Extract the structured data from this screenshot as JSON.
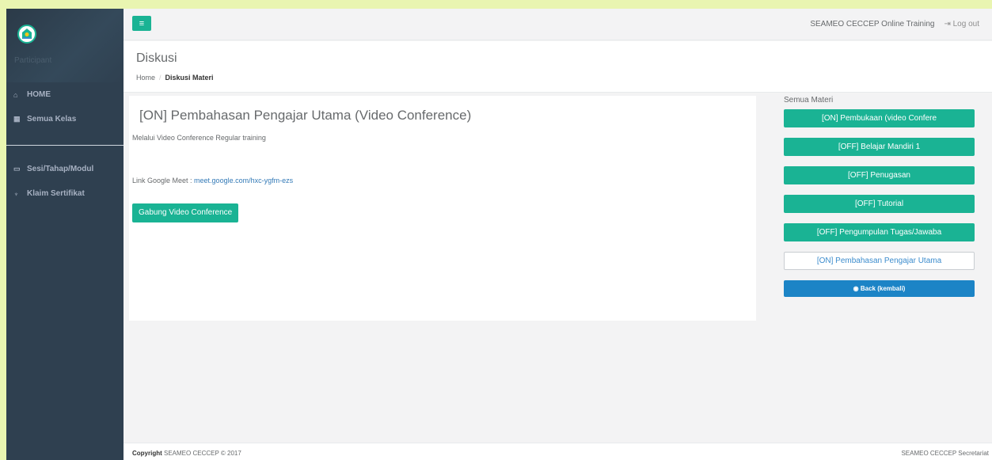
{
  "sidebar": {
    "role": "Participant",
    "items": [
      {
        "label": "HOME",
        "icon": "home-icon"
      },
      {
        "label": "Semua Kelas",
        "icon": "calendar-icon"
      },
      {
        "label": "Sesi/Tahap/Modul",
        "icon": "folder-icon"
      },
      {
        "label": "Klaim Sertifikat",
        "icon": "trophy-icon"
      }
    ]
  },
  "topbar": {
    "menu_icon": "≡",
    "site_name": "SEAMEO CECCEP Online Training",
    "logout_label": "Log out"
  },
  "heading": {
    "title": "Diskusi",
    "breadcrumb_home": "Home",
    "breadcrumb_current": "Diskusi Materi"
  },
  "content": {
    "title": "[ON] Pembahasan Pengajar Utama (Video Conference)",
    "description": "Melalui Video Conference Regular training",
    "link_label": "Link  Google Meet : ",
    "link_url": "meet.google.com/hxc-ygfm-ezs",
    "join_label": "Gabung Video Conference"
  },
  "materials": {
    "title": "Semua Materi",
    "items": [
      "[ON] Pembukaan (video Confere",
      "[OFF] Belajar Mandiri 1",
      "[OFF] Penugasan",
      "[OFF] Tutorial",
      "[OFF] Pengumpulan Tugas/Jawaba",
      "[ON] Pembahasan Pengajar Utama"
    ],
    "back_label": "Back (kembali)"
  },
  "footer": {
    "copyright_bold": "Copyright",
    "copyright_text": " SEAMEO CECCEP © 2017",
    "right_text": "SEAMEO CECCEP Secretariat"
  },
  "colors": {
    "primary": "#1ab394",
    "sidebar": "#2f4050",
    "back_button": "#1c84c6",
    "outer_background": "#e9f5b1"
  }
}
